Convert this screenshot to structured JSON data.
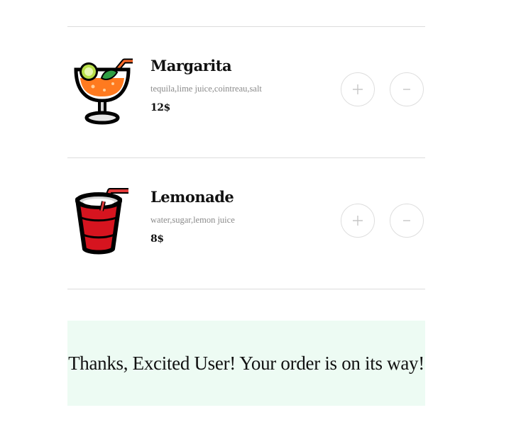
{
  "menu": {
    "items": [
      {
        "name": "Margarita",
        "ingredients": "tequila,lime juice,cointreau,salt",
        "price": "12$",
        "icon": "margarita-glass-icon",
        "add_icon": "plus-icon",
        "remove_icon": "minus-icon"
      },
      {
        "name": "Lemonade",
        "ingredients": "water,sugar,lemon juice",
        "price": "8$",
        "icon": "cup-with-straw-icon",
        "add_icon": "plus-icon",
        "remove_icon": "minus-icon"
      }
    ]
  },
  "confirmation": {
    "message": "Thanks, Excited User! Your order is on its way!"
  },
  "colors": {
    "banner_background": "#edfbf3",
    "divider": "#dcdcdc",
    "button_border": "#dedede",
    "ingredients_text": "#8a8a8a"
  }
}
